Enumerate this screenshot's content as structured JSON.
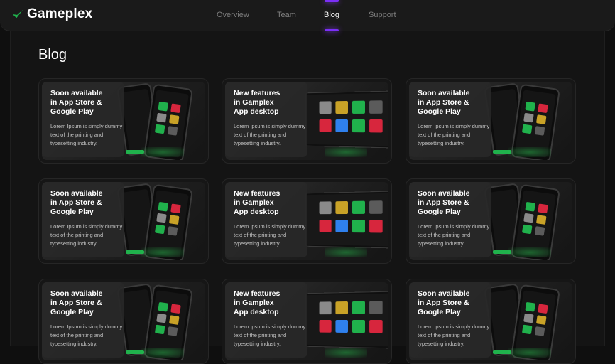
{
  "brand": {
    "name": "Gameplex",
    "accent": "#20b14c"
  },
  "nav": [
    {
      "label": "Overview",
      "active": false
    },
    {
      "label": "Team",
      "active": false
    },
    {
      "label": "Blog",
      "active": true
    },
    {
      "label": "Support",
      "active": false
    }
  ],
  "page": {
    "title": "Blog"
  },
  "cards": [
    {
      "variant": "phone",
      "title": "Soon available\nin App Store &\nGoogle Play",
      "desc": "Lorem Ipsum is simply dummy text of the printing and typesetting industry."
    },
    {
      "variant": "laptop",
      "title": "New features\nin Gamplex\nApp desktop",
      "desc": "Lorem Ipsum is simply dummy text of the printing and typesetting industry."
    },
    {
      "variant": "phone",
      "title": "Soon available\nin App Store &\nGoogle Play",
      "desc": "Lorem Ipsum is simply dummy text of the printing and typesetting industry."
    },
    {
      "variant": "phone",
      "title": "Soon available\nin App Store &\nGoogle Play",
      "desc": "Lorem Ipsum is simply dummy text of the printing and typesetting industry."
    },
    {
      "variant": "laptop",
      "title": "New features\nin Gamplex\nApp desktop",
      "desc": "Lorem Ipsum is simply dummy text of the printing and typesetting industry."
    },
    {
      "variant": "phone",
      "title": "Soon available\nin App Store &\nGoogle Play",
      "desc": "Lorem Ipsum is simply dummy text of the printing and typesetting industry."
    },
    {
      "variant": "phone",
      "title": "Soon available\nin App Store &\nGoogle Play",
      "desc": "Lorem Ipsum is simply dummy text of the printing and typesetting industry."
    },
    {
      "variant": "laptop",
      "title": "New features\nin Gamplex\nApp desktop",
      "desc": "Lorem Ipsum is simply dummy text of the printing and typesetting industry."
    },
    {
      "variant": "phone",
      "title": "Soon available\nin App Store &\nGoogle Play",
      "desc": "Lorem Ipsum is simply dummy text of the printing and typesetting industry."
    }
  ]
}
